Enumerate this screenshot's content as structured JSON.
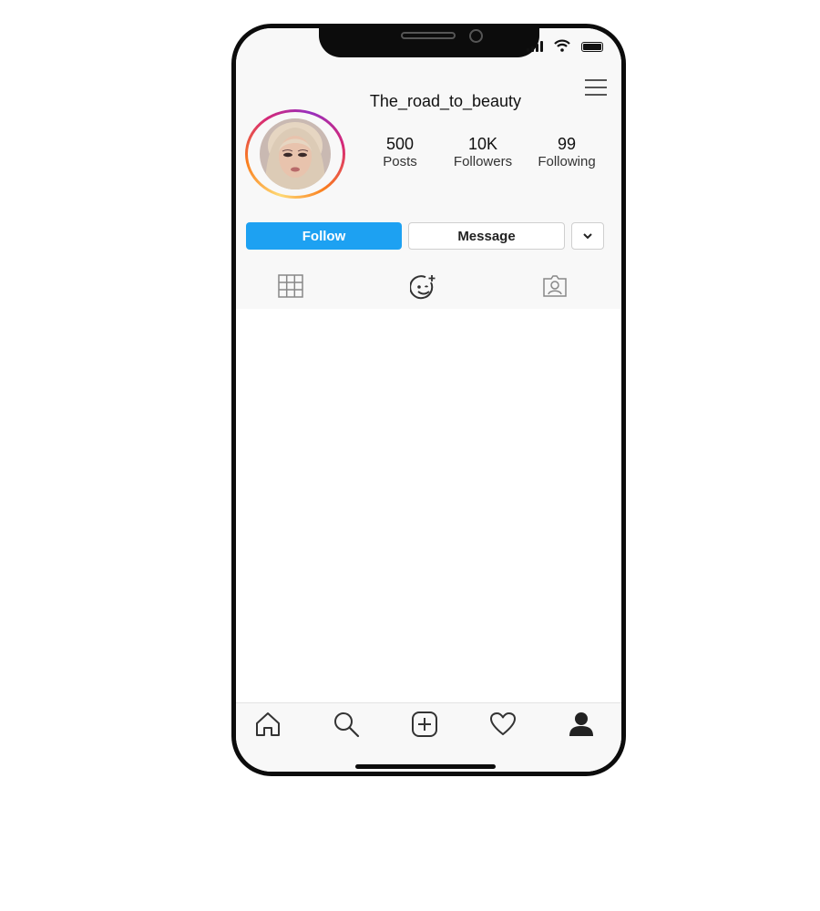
{
  "profile": {
    "username": "The_road_to_beauty",
    "stats": [
      {
        "value": "500",
        "label": "Posts"
      },
      {
        "value": "10K",
        "label": "Followers"
      },
      {
        "value": "99",
        "label": "Following"
      }
    ]
  },
  "actions": {
    "follow_label": "Follow",
    "message_label": "Message"
  },
  "tabs": [
    "grid-icon",
    "face-sparkle-icon",
    "tagged-person-icon"
  ],
  "bottom_nav": [
    "home-icon",
    "search-icon",
    "add-post-icon",
    "heart-icon",
    "profile-icon"
  ],
  "colors": {
    "follow_button": "#1da1f2",
    "avatar_ring": [
      "#feda75",
      "#fa7e1e",
      "#d62976",
      "#962fbf"
    ]
  }
}
